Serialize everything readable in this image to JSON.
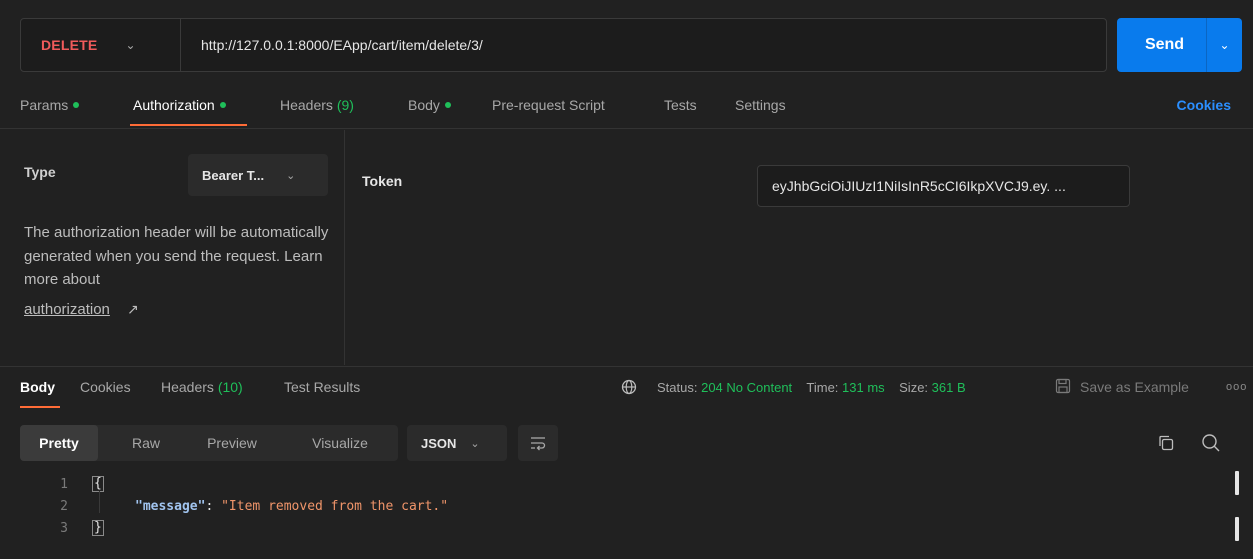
{
  "request": {
    "method": "DELETE",
    "url": "http://127.0.0.1:8000/EApp/cart/item/delete/3/",
    "send_label": "Send"
  },
  "request_tabs": [
    {
      "label": "Params",
      "dot": true
    },
    {
      "label": "Authorization",
      "dot": true,
      "active": true
    },
    {
      "label": "Headers",
      "count": "(9)"
    },
    {
      "label": "Body",
      "dot": true
    },
    {
      "label": "Pre-request Script"
    },
    {
      "label": "Tests"
    },
    {
      "label": "Settings"
    }
  ],
  "cookies_link": "Cookies",
  "auth": {
    "type_label": "Type",
    "type_value": "Bearer T...",
    "description": "The authorization header will be automatically generated when you send the request. Learn more about",
    "link_text": "authorization",
    "link_arrow": "↗",
    "token_label": "Token",
    "token_value": "eyJhbGciOiJIUzI1NiIsInR5cCI6IkpXVCJ9.ey. ..."
  },
  "response_tabs": [
    {
      "label": "Body",
      "active": true
    },
    {
      "label": "Cookies"
    },
    {
      "label": "Headers",
      "count": "(10)"
    },
    {
      "label": "Test Results"
    }
  ],
  "response_status": {
    "status_label": "Status:",
    "status_value": "204 No Content",
    "time_label": "Time:",
    "time_value": "131 ms",
    "size_label": "Size:",
    "size_value": "361 B",
    "save_example": "Save as Example",
    "more": "ooo"
  },
  "view_modes": [
    "Pretty",
    "Raw",
    "Preview",
    "Visualize"
  ],
  "format_select": "JSON",
  "code": {
    "line_numbers": [
      "1",
      "2",
      "3"
    ],
    "open_brace": "{",
    "close_brace": "}",
    "key": "\"message\"",
    "colon": ": ",
    "value": "\"Item removed from the cart.\""
  },
  "colors": {
    "method": "#f05b5b",
    "send": "#097bed",
    "accent": "#ff6c37",
    "success": "#1fbf5a",
    "link": "#2b8fff"
  }
}
